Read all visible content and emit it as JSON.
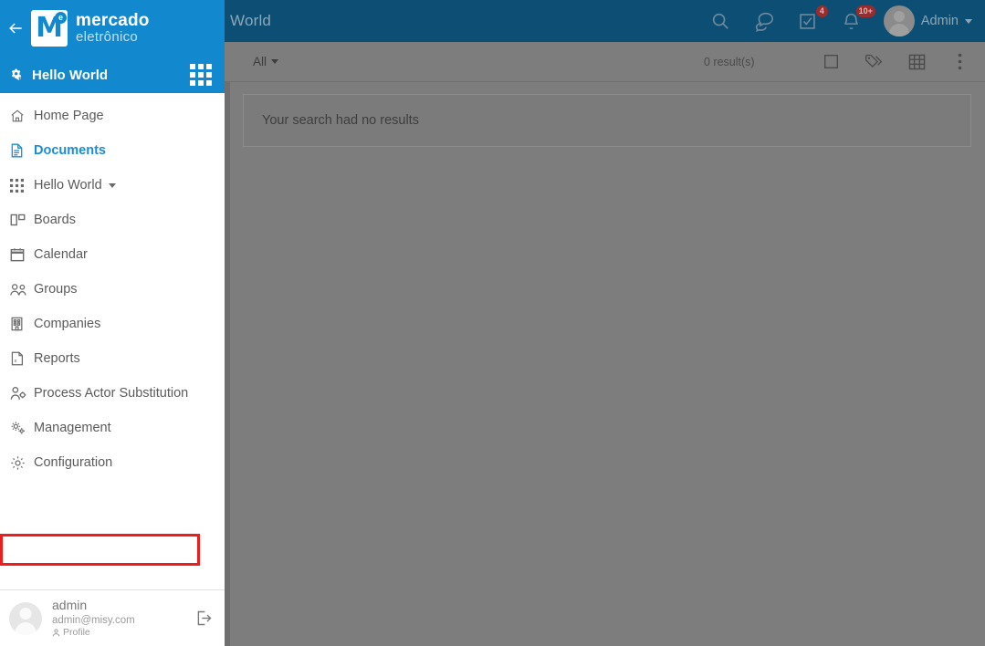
{
  "header": {
    "page_title": "World",
    "icons": [
      {
        "name": "search-icon",
        "badge": ""
      },
      {
        "name": "chat-icon",
        "badge": ""
      },
      {
        "name": "tasks-icon",
        "badge": "4"
      },
      {
        "name": "bell-icon",
        "badge": "10+"
      }
    ],
    "user_label": "Admin"
  },
  "toolbar": {
    "filter_label": "All",
    "results_label": "0 result(s)",
    "icons": [
      "checkbox-icon",
      "tag-icon",
      "grid-view-icon",
      "more-vertical-icon"
    ]
  },
  "content": {
    "empty_message": "Your search had no results"
  },
  "sidebar": {
    "logo": {
      "line1": "mercado",
      "line2": "eletrônico",
      "mark_letter": "M",
      "mark_badge": "e"
    },
    "app_switcher": {
      "label": "Hello World"
    },
    "items": [
      {
        "label": "Home Page",
        "icon": "home-icon",
        "active": false,
        "caret": false
      },
      {
        "label": "Documents",
        "icon": "document-icon",
        "active": true,
        "caret": false
      },
      {
        "label": "Hello World",
        "icon": "grid-icon",
        "active": false,
        "caret": true
      },
      {
        "label": "Boards",
        "icon": "boards-icon",
        "active": false,
        "caret": false
      },
      {
        "label": "Calendar",
        "icon": "calendar-icon",
        "active": false,
        "caret": false
      },
      {
        "label": "Groups",
        "icon": "groups-icon",
        "active": false,
        "caret": false
      },
      {
        "label": "Companies",
        "icon": "building-icon",
        "active": false,
        "caret": false
      },
      {
        "label": "Reports",
        "icon": "report-icon",
        "active": false,
        "caret": false
      },
      {
        "label": "Process Actor Substitution",
        "icon": "user-gear-icon",
        "active": false,
        "caret": false
      },
      {
        "label": "Management",
        "icon": "gears-icon",
        "active": false,
        "caret": false
      },
      {
        "label": "Configuration",
        "icon": "gear-icon",
        "active": false,
        "caret": false
      }
    ],
    "user": {
      "name": "admin",
      "email": "admin@misy.com",
      "profile_label": "Profile"
    }
  },
  "colors": {
    "brand_blue": "#1288ce",
    "header_blue": "#0d4f74",
    "active_blue": "#1a8cd8",
    "highlight_red": "#ee1c1c",
    "overlay_gray": "#7d7d7d"
  }
}
